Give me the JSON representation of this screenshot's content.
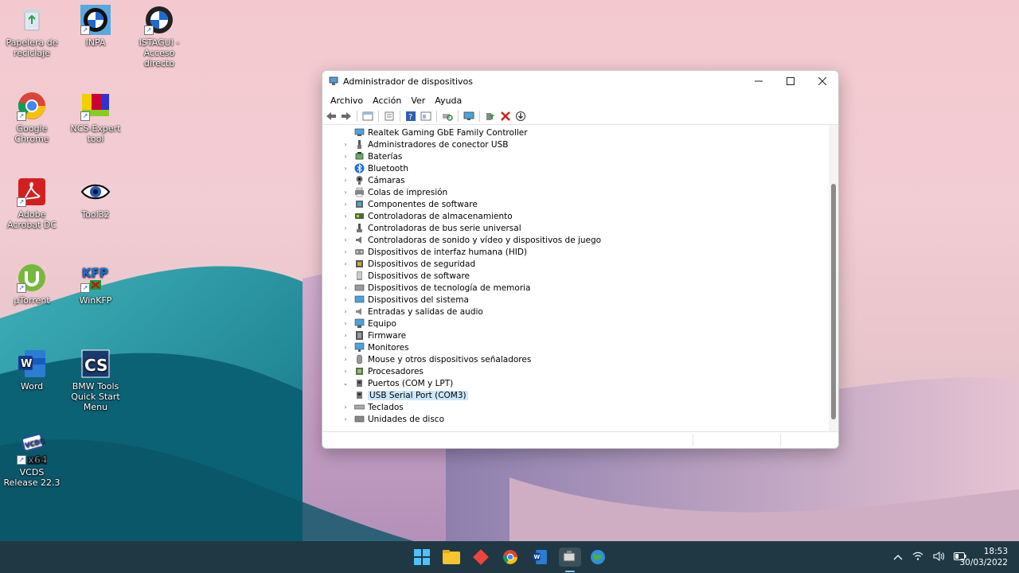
{
  "desktop": {
    "icons": [
      {
        "label": "Papelera de reciclaje",
        "icon": "recycle-bin-icon"
      },
      {
        "label": "INPA",
        "icon": "bmw-logo-icon"
      },
      {
        "label": "ISTAGUI - Acceso directo",
        "icon": "bmw-logo-icon"
      },
      {
        "label": "Google Chrome",
        "icon": "chrome-icon"
      },
      {
        "label": "NCS-Expert tool",
        "icon": "ncs-expert-icon"
      },
      {
        "label": "Adobe Acrobat DC",
        "icon": "acrobat-icon"
      },
      {
        "label": "Tool32",
        "icon": "eye-icon"
      },
      {
        "label": "µTorrent",
        "icon": "utorrent-icon"
      },
      {
        "label": "WinKFP",
        "icon": "winkfp-icon"
      },
      {
        "label": "Word",
        "icon": "word-icon"
      },
      {
        "label": "BMW Tools Quick Start Menu",
        "icon": "bmw-tools-icon"
      },
      {
        "label": "VCDS Release 22.3",
        "icon": "vcds-icon"
      }
    ]
  },
  "window": {
    "title": "Administrador de dispositivos",
    "menu": [
      "Archivo",
      "Acción",
      "Ver",
      "Ayuda"
    ],
    "tree": [
      {
        "label": "Realtek Gaming GbE Family Controller",
        "child": true,
        "icon": "network-adapter-icon"
      },
      {
        "label": "Administradores de conector USB",
        "icon": "usb-connector-icon"
      },
      {
        "label": "Baterías",
        "icon": "battery-icon"
      },
      {
        "label": "Bluetooth",
        "icon": "bluetooth-icon"
      },
      {
        "label": "Cámaras",
        "icon": "camera-icon"
      },
      {
        "label": "Colas de impresión",
        "icon": "printer-icon"
      },
      {
        "label": "Componentes de software",
        "icon": "software-component-icon"
      },
      {
        "label": "Controladoras de almacenamiento",
        "icon": "storage-controller-icon"
      },
      {
        "label": "Controladoras de bus serie universal",
        "icon": "usb-icon"
      },
      {
        "label": "Controladoras de sonido y vídeo y dispositivos de juego",
        "icon": "sound-icon"
      },
      {
        "label": "Dispositivos de interfaz humana (HID)",
        "icon": "hid-icon"
      },
      {
        "label": "Dispositivos de seguridad",
        "icon": "security-icon"
      },
      {
        "label": "Dispositivos de software",
        "icon": "software-device-icon"
      },
      {
        "label": "Dispositivos de tecnología de memoria",
        "icon": "memory-icon"
      },
      {
        "label": "Dispositivos del sistema",
        "icon": "system-device-icon"
      },
      {
        "label": "Entradas y salidas de audio",
        "icon": "audio-io-icon"
      },
      {
        "label": "Equipo",
        "icon": "computer-icon"
      },
      {
        "label": "Firmware",
        "icon": "firmware-icon"
      },
      {
        "label": "Monitores",
        "icon": "monitor-icon"
      },
      {
        "label": "Mouse y otros dispositivos señaladores",
        "icon": "mouse-icon"
      },
      {
        "label": "Procesadores",
        "icon": "processor-icon"
      },
      {
        "label": "Puertos (COM y LPT)",
        "expanded": true,
        "icon": "port-icon"
      },
      {
        "label": "USB Serial Port (COM3)",
        "child": true,
        "selected": true,
        "icon": "port-icon"
      },
      {
        "label": "Teclados",
        "icon": "keyboard-icon"
      },
      {
        "label": "Unidades de disco",
        "icon": "disk-drive-icon"
      }
    ]
  },
  "taskbar": {
    "apps": [
      "start-icon",
      "file-explorer-icon",
      "anydesk-icon",
      "chrome-icon",
      "word-icon",
      "device-manager-icon",
      "globe-app-icon"
    ],
    "time": "18:53",
    "date": "30/03/2022"
  }
}
